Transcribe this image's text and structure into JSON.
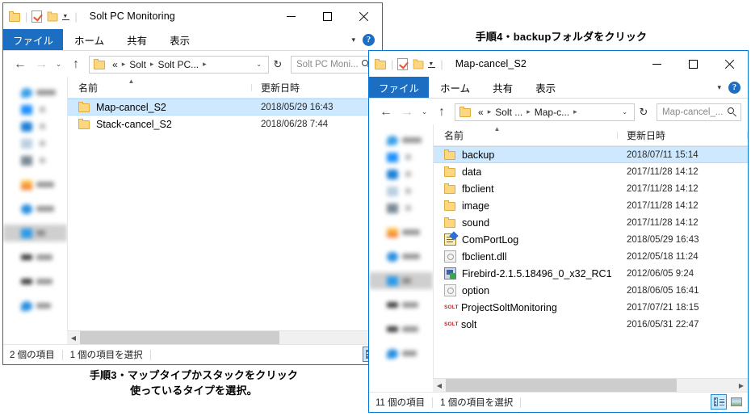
{
  "annotations": {
    "top": "手順4・backupフォルダをクリック",
    "bottom_line1": "手順3・マップタイプかスタックをクリック",
    "bottom_line2": "使っているタイプを選択。"
  },
  "colors": {
    "accent": "#0078d7",
    "file_tab": "#1b6ec2",
    "selection": "#cde8ff",
    "folder": "#fcd77f",
    "solt_red": "#cc1f1f"
  },
  "left_window": {
    "title": "Solt PC Monitoring",
    "quick_access": [
      "folder-icon",
      "properties-icon",
      "new-folder-icon",
      "customize-caret-icon"
    ],
    "window_buttons": {
      "minimize": "minimize-icon",
      "maximize": "maximize-icon",
      "close": "close-icon"
    },
    "ribbon_tabs": [
      {
        "label": "ファイル",
        "active": true
      },
      {
        "label": "ホーム",
        "active": false
      },
      {
        "label": "共有",
        "active": false
      },
      {
        "label": "表示",
        "active": false
      }
    ],
    "ribbon_help": "?",
    "address": {
      "back": "←",
      "forward": "→",
      "recent_caret": "⌄",
      "up": "↑",
      "crumbs": [
        "«",
        "Solt",
        "Solt PC...",
        ""
      ],
      "dropdown_caret": "⌄",
      "refresh": "↻"
    },
    "search": {
      "placeholder": "Solt PC Moni..."
    },
    "columns": {
      "name": "名前",
      "date": "更新日時"
    },
    "rows": [
      {
        "icon": "folder-icon",
        "name": "Map-cancel_S2",
        "date": "2018/05/29 16:43",
        "selected": true
      },
      {
        "icon": "folder-icon",
        "name": "Stack-cancel_S2",
        "date": "2018/06/28 7:44",
        "selected": false
      }
    ],
    "status": {
      "count": "2 個の項目",
      "selected": "1 個の項目を選択"
    },
    "view_buttons": {
      "details": "details-view-icon",
      "details_active": true
    }
  },
  "right_window": {
    "title": "Map-cancel_S2",
    "quick_access": [
      "folder-icon",
      "properties-icon",
      "new-folder-icon",
      "customize-caret-icon"
    ],
    "window_buttons": {
      "minimize": "minimize-icon",
      "maximize": "maximize-icon",
      "close": "close-icon"
    },
    "ribbon_tabs": [
      {
        "label": "ファイル",
        "active": true
      },
      {
        "label": "ホーム",
        "active": false
      },
      {
        "label": "共有",
        "active": false
      },
      {
        "label": "表示",
        "active": false
      }
    ],
    "ribbon_help": "?",
    "address": {
      "back": "←",
      "forward": "→",
      "recent_caret": "⌄",
      "up": "↑",
      "crumbs": [
        "«",
        "Solt ...",
        "Map-c...",
        ""
      ],
      "dropdown_caret": "⌄",
      "refresh": "↻"
    },
    "search": {
      "placeholder": "Map-cancel_..."
    },
    "columns": {
      "name": "名前",
      "date": "更新日時"
    },
    "rows": [
      {
        "icon": "folder-icon",
        "name": "backup",
        "date": "2018/07/11 15:14",
        "selected": true
      },
      {
        "icon": "folder-icon",
        "name": "data",
        "date": "2017/11/28 14:12",
        "selected": false
      },
      {
        "icon": "folder-icon",
        "name": "fbclient",
        "date": "2017/11/28 14:12",
        "selected": false
      },
      {
        "icon": "folder-icon",
        "name": "image",
        "date": "2017/11/28 14:12",
        "selected": false
      },
      {
        "icon": "folder-icon",
        "name": "sound",
        "date": "2017/11/28 14:12",
        "selected": false
      },
      {
        "icon": "log-file-icon",
        "name": "ComPortLog",
        "date": "2018/05/29 16:43",
        "selected": false
      },
      {
        "icon": "dll-file-icon",
        "name": "fbclient.dll",
        "date": "2012/05/18 11:24",
        "selected": false
      },
      {
        "icon": "installer-icon",
        "name": "Firebird-2.1.5.18496_0_x32_RC1",
        "date": "2012/06/05 9:24",
        "selected": false
      },
      {
        "icon": "config-file-icon",
        "name": "option",
        "date": "2018/06/05 16:41",
        "selected": false
      },
      {
        "icon": "solt-app-icon",
        "name": "ProjectSoltMonitoring",
        "date": "2017/07/21 18:15",
        "selected": false
      },
      {
        "icon": "solt-app-icon",
        "name": "solt",
        "date": "2016/05/31 22:47",
        "selected": false
      }
    ],
    "solt_icon_text": "SOLT",
    "status": {
      "count": "11 個の項目",
      "selected": "1 個の項目を選択"
    },
    "view_buttons": {
      "details": "details-view-icon",
      "details_active": true,
      "tiles": "tiles-view-icon"
    }
  }
}
